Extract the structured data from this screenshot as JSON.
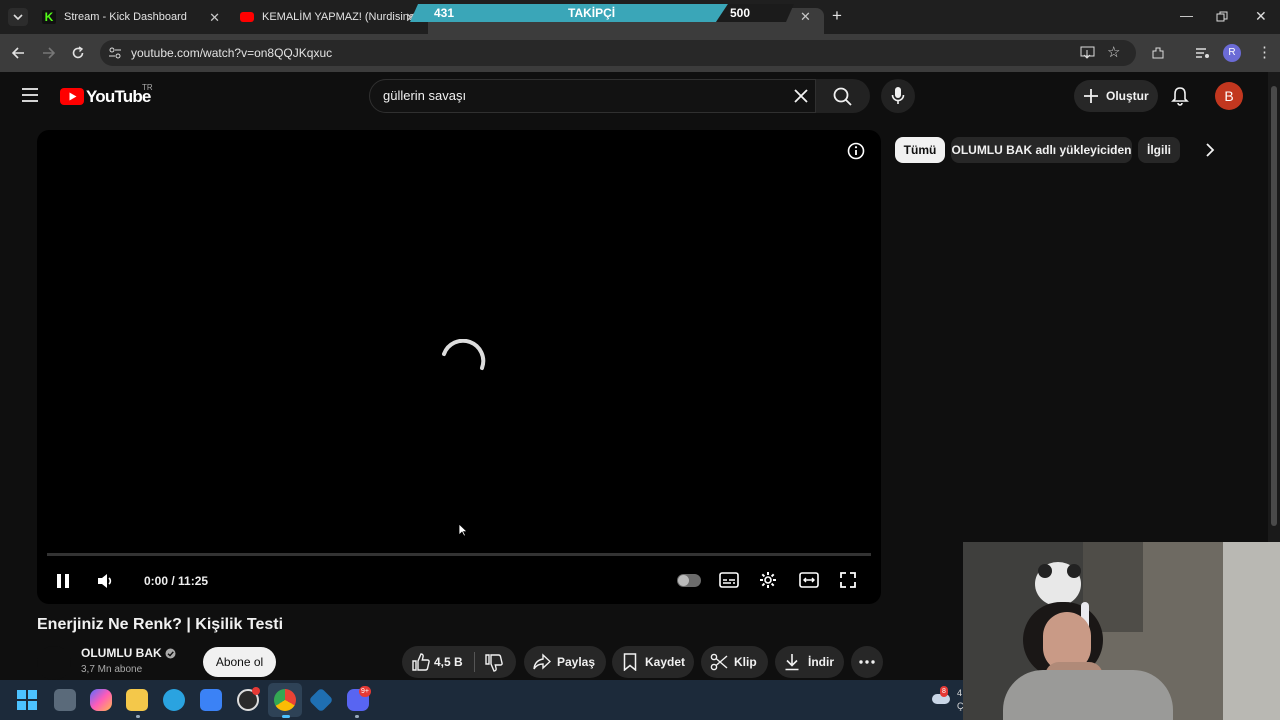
{
  "browser": {
    "tabs": [
      {
        "title": "Stream - Kick Dashboard"
      },
      {
        "title": "KEMALİM YAPMAZ! (Nurdisina"
      }
    ],
    "new_tab_label": "+",
    "url": "youtube.com/watch?v=on8QQJKqxuc",
    "profile_initial": "R"
  },
  "overlay": {
    "follow_current": "431",
    "follow_label": "TAKİPÇİ",
    "follow_goal": "500"
  },
  "youtube": {
    "logo_text": "YouTube",
    "region": "TR",
    "search_query": "güllerin savaşı",
    "create_label": "Oluştur",
    "avatar_initial": "B"
  },
  "player": {
    "current_time": "0:00",
    "duration": "11:25",
    "time_display": "0:00 / 11:25",
    "progress": 0
  },
  "chips": [
    "Tümü",
    "OLUMLU BAK adlı yükleyiciden",
    "İlgili"
  ],
  "video": {
    "title": "Enerjiniz Ne Renk? | Kişilik Testi",
    "channel": "OLUMLU BAK",
    "subscribers": "3,7 Mn abone",
    "subscribe_label": "Abone ol",
    "likes": "4,5 B",
    "share_label": "Paylaş",
    "save_label": "Kaydet",
    "clip_label": "Klip",
    "download_label": "İndir"
  },
  "taskbar": {
    "discord_badge": "9+",
    "tray_badge": "8",
    "tray_text_1": "4",
    "tray_text_2": "Ç"
  },
  "colors": {
    "yt_red": "#ff0000",
    "background": "#0f0f0f",
    "overlay_teal": "#3aa6b8"
  }
}
